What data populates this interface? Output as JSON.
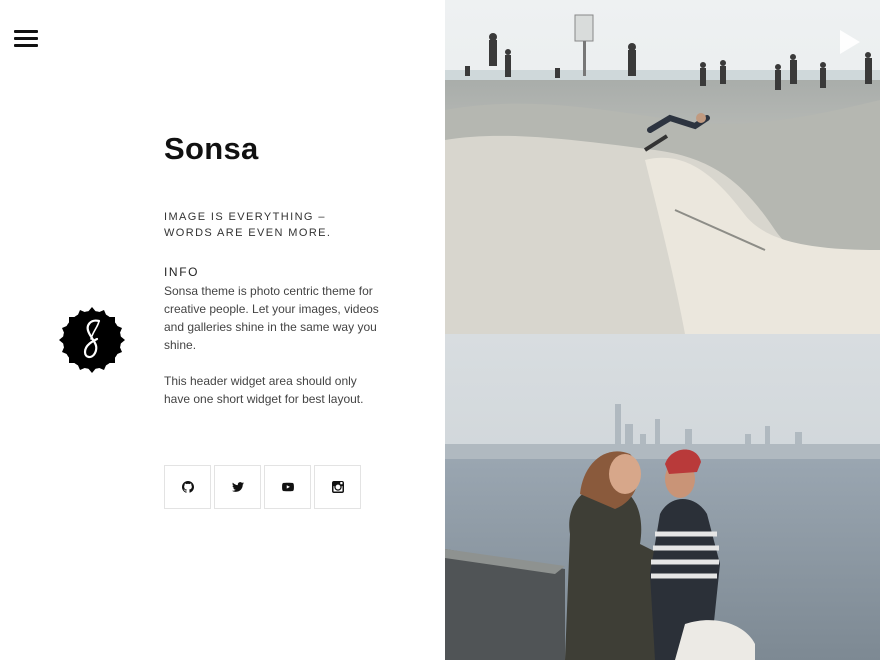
{
  "site": {
    "title": "Sonsa",
    "tagline": "IMAGE IS EVERYTHING – WORDS ARE EVEN MORE."
  },
  "widget": {
    "title": "INFO",
    "paragraphs": [
      "Sonsa theme is photo centric theme for creative people. Let your images, videos and galleries shine in the same way you shine.",
      "This header widget area should only have one short widget for best layout."
    ]
  },
  "social": [
    {
      "name": "github",
      "icon": "github-icon"
    },
    {
      "name": "twitter",
      "icon": "twitter-icon"
    },
    {
      "name": "youtube",
      "icon": "youtube-icon"
    },
    {
      "name": "instagram",
      "icon": "instagram-icon"
    }
  ],
  "icons": {
    "menu": "hamburger-menu-icon",
    "logo": "sonsa-logo-seal",
    "slider_next": "play-icon"
  },
  "photos": [
    {
      "subject": "skatepark"
    },
    {
      "subject": "couple-by-waterfront"
    }
  ],
  "colors": {
    "text": "#111111",
    "border": "#e3e3e3",
    "background": "#ffffff"
  }
}
